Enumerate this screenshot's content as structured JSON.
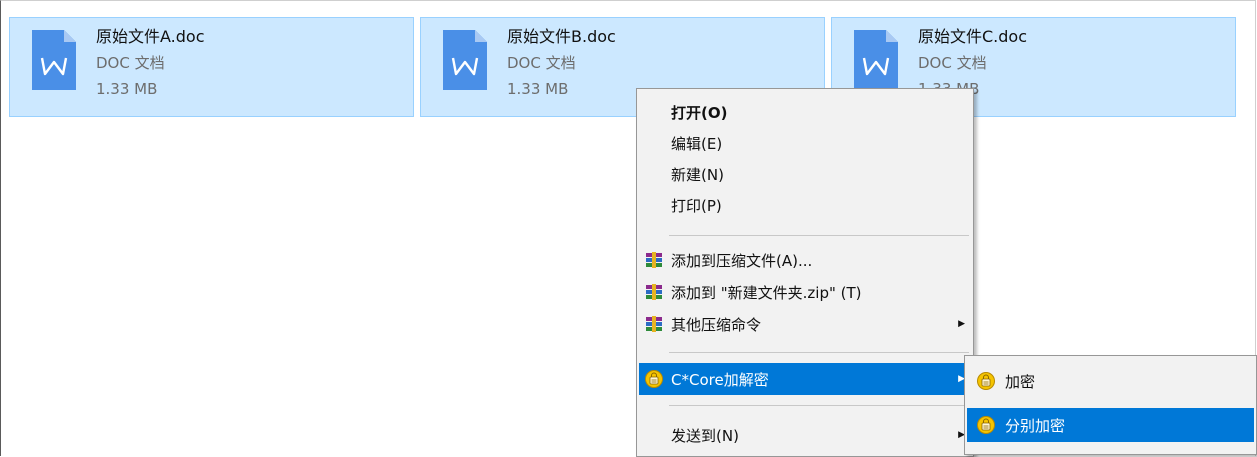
{
  "files": [
    {
      "name": "原始文件A.doc",
      "type": "DOC 文档",
      "size": "1.33 MB"
    },
    {
      "name": "原始文件B.doc",
      "type": "DOC 文档",
      "size": "1.33 MB"
    },
    {
      "name": "原始文件C.doc",
      "type": "DOC 文档",
      "size": "1.33 MB"
    }
  ],
  "context_menu": {
    "items": [
      {
        "label": "打开(O)"
      },
      {
        "label": "编辑(E)"
      },
      {
        "label": "新建(N)"
      },
      {
        "label": "打印(P)"
      },
      {
        "label": "添加到压缩文件(A)...",
        "icon": "winrar-icon"
      },
      {
        "label": "添加到 \"新建文件夹.zip\" (T)",
        "icon": "winrar-icon"
      },
      {
        "label": "其他压缩命令",
        "icon": "winrar-icon"
      },
      {
        "label": "C*Core加解密",
        "icon": "lock-badge-icon"
      },
      {
        "label": "发送到(N)"
      }
    ]
  },
  "submenu": {
    "items": [
      {
        "label": "加密",
        "icon": "lock-badge-icon"
      },
      {
        "label": "分别加密",
        "icon": "lock-badge-icon"
      }
    ]
  },
  "colors": {
    "selection_bg": "#cce8ff",
    "selection_border": "#99d1ff",
    "menu_highlight": "#0078d7",
    "doc_icon_blue": "#4a8fe7"
  }
}
